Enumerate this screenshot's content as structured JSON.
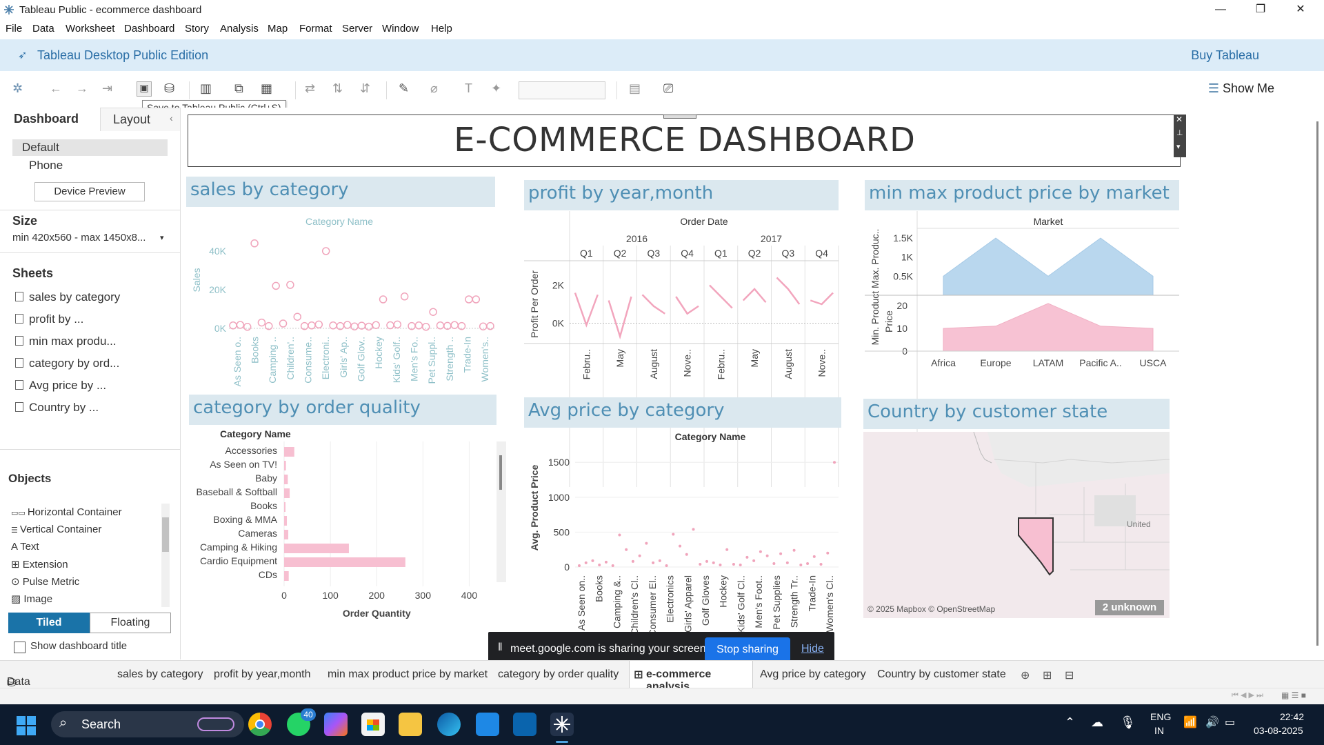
{
  "window": {
    "title": "Tableau Public - ecommerce dashboard",
    "min": "—",
    "max": "❐",
    "close": "✕"
  },
  "menu": [
    "File",
    "Data",
    "Worksheet",
    "Dashboard",
    "Story",
    "Analysis",
    "Map",
    "Format",
    "Server",
    "Window",
    "Help"
  ],
  "banner": {
    "edition": "Tableau Desktop Public Edition",
    "buy": "Buy Tableau"
  },
  "toolbar": {
    "tooltip": "Save to Tableau Public (Ctrl+S)",
    "show_me": "Show Me"
  },
  "left": {
    "tab_dashboard": "Dashboard",
    "tab_layout": "Layout",
    "devices": [
      "Default",
      "Phone"
    ],
    "device_preview": "Device Preview",
    "size_label": "Size",
    "size_value": "min 420x560 - max 1450x8...",
    "sheets_label": "Sheets",
    "sheets": [
      "sales by category",
      "profit by ...",
      "min max produ...",
      "category by ord...",
      "Avg price by ...",
      "Country by ..."
    ],
    "objects_label": "Objects",
    "objects": [
      "Horizontal Container",
      "Vertical Container",
      "Text",
      "Extension",
      "Pulse Metric",
      "Image"
    ],
    "tiled": "Tiled",
    "floating": "Floating",
    "show_title": "Show dashboard title"
  },
  "dashboard_title": "E-COMMERCE DASHBOARD",
  "panes": {
    "sales": {
      "title": "sales by category",
      "header": "Category Name",
      "ylabel": "Sales",
      "yticks": [
        "40K",
        "20K",
        "0K"
      ],
      "categories": [
        "As Seen o..",
        "Books",
        "Camping ..",
        "Children'..",
        "Consume..",
        "Electroni..",
        "Girls' Ap..",
        "Golf Glov..",
        "Hockey",
        "Kids' Golf..",
        "Men's Fo..",
        "Pet Suppl..",
        "Strength ..",
        "Trade-In",
        "Women's.."
      ]
    },
    "profit": {
      "title": "profit by year,month",
      "header": "Order Date",
      "years": [
        "2016",
        "2017"
      ],
      "quarters": [
        "Q1",
        "Q2",
        "Q3",
        "Q4",
        "Q1",
        "Q2",
        "Q3",
        "Q4"
      ],
      "ylabel": "Profit Per Order",
      "yticks": [
        "2K",
        "0K"
      ],
      "months": [
        "Febru..",
        "May",
        "August",
        "Nove..",
        "Febru..",
        "May",
        "August",
        "Nove.."
      ]
    },
    "minmax": {
      "title": "min max product price by market",
      "header": "Market",
      "ylabel1": "Min. Product Max. Produc..",
      "ylabel2": "Price",
      "yticks_top": [
        "1.5K",
        "1K",
        "0.5K"
      ],
      "yticks_bot": [
        "20",
        "10",
        "0"
      ],
      "markets": [
        "Africa",
        "Europe",
        "LATAM",
        "Pacific A..",
        "USCA"
      ]
    },
    "quality": {
      "title": "category by order quality",
      "header": "Category Name",
      "xlabel": "Order Quantity",
      "xticks": [
        "0",
        "100",
        "200",
        "300",
        "400"
      ],
      "categories": [
        "Accessories",
        "As Seen on  TV!",
        "Baby",
        "Baseball & Softball",
        "Books",
        "Boxing & MMA",
        "Cameras",
        "Camping & Hiking",
        "Cardio Equipment",
        "CDs"
      ]
    },
    "avg": {
      "title": "Avg price by category",
      "header": "Category Name",
      "ylabel": "Avg. Product Price",
      "yticks": [
        "1500",
        "1000",
        "500",
        "0"
      ],
      "categories": [
        "As Seen on..",
        "Books",
        "Camping &..",
        "Children's Cl..",
        "Consumer El..",
        "Electronics",
        "Girls' Apparel",
        "Golf Gloves",
        "Hockey",
        "Kids' Golf Cl..",
        "Men's Foot..",
        "Pet Supplies",
        "Strength Tr..",
        "Trade-In",
        "Women's Cl.."
      ]
    },
    "country": {
      "title": "Country by customer state",
      "attribution": "© 2025 Mapbox © OpenStreetMap",
      "unknown": "2 unknown",
      "label": "United"
    }
  },
  "tabs": [
    "Data Source",
    "sales by category",
    "profit by year,month",
    "min max product price by market",
    "category by order quality",
    "e-commerce analysis",
    "Avg price by category",
    "Country by customer state"
  ],
  "share": {
    "text": "meet.google.com is sharing your screen.",
    "stop": "Stop sharing",
    "hide": "Hide"
  },
  "taskbar": {
    "search": "Search",
    "lang1": "ENG",
    "lang2": "IN",
    "time": "22:42",
    "date": "03-08-2025",
    "badge": "40"
  },
  "chart_data": [
    {
      "type": "scatter",
      "title": "sales by category",
      "xlabel": "Category Name",
      "ylabel": "Sales",
      "ylim": [
        0,
        50000
      ],
      "values": [
        1500,
        1800,
        800,
        44000,
        3000,
        1200,
        22000,
        2500,
        22500,
        6000,
        1200,
        1500,
        2000,
        40000,
        1500,
        1200,
        1800,
        1000,
        1400,
        900,
        1700,
        15000,
        1600,
        2000,
        16500,
        1200,
        1500,
        800,
        8500,
        1500,
        1300,
        1700,
        1200,
        15000,
        15000,
        1000,
        1200
      ]
    },
    {
      "type": "line",
      "title": "profit by year,month",
      "ylabel": "Profit Per Order",
      "ylim": [
        -1000,
        3000
      ],
      "series": [
        {
          "values": [
            1600,
            -100,
            1500
          ]
        },
        {
          "values": [
            1200,
            -700,
            1400
          ]
        },
        {
          "values": [
            1500,
            900,
            500
          ]
        },
        {
          "values": [
            1400,
            500,
            900
          ]
        },
        {
          "values": [
            2000,
            1400,
            800
          ]
        },
        {
          "values": [
            1200,
            1800,
            1100
          ]
        },
        {
          "values": [
            2400,
            1800,
            1000
          ]
        },
        {
          "values": [
            1200,
            1000,
            1600
          ]
        }
      ]
    },
    {
      "type": "area",
      "title": "min max product price by market",
      "categories": [
        "Africa",
        "Europe",
        "LATAM",
        "Pacific A..",
        "USCA"
      ],
      "series": [
        {
          "name": "Max. Product Price",
          "values": [
            500,
            1500,
            500,
            1500,
            500
          ]
        },
        {
          "name": "Min. Product Price",
          "values": [
            10,
            11,
            21,
            11,
            10
          ]
        }
      ]
    },
    {
      "type": "bar",
      "title": "category by order quality",
      "xlabel": "Order Quantity",
      "xlim": [
        0,
        450
      ],
      "categories": [
        "Accessories",
        "As Seen on  TV!",
        "Baby",
        "Baseball & Softball",
        "Books",
        "Boxing & MMA",
        "Cameras",
        "Camping & Hiking",
        "Cardio Equipment",
        "CDs"
      ],
      "values": [
        22,
        4,
        8,
        12,
        3,
        6,
        9,
        140,
        262,
        10
      ]
    },
    {
      "type": "scatter",
      "title": "Avg price by category",
      "ylabel": "Avg. Product Price",
      "ylim": [
        0,
        1700
      ],
      "values": [
        20,
        60,
        90,
        30,
        70,
        20,
        460,
        250,
        80,
        160,
        340,
        60,
        90,
        20,
        470,
        300,
        180,
        540,
        40,
        80,
        60,
        30,
        250,
        40,
        30,
        140,
        90,
        220,
        160,
        50,
        190,
        60,
        240,
        30,
        50,
        150,
        40,
        200,
        1500
      ]
    }
  ]
}
